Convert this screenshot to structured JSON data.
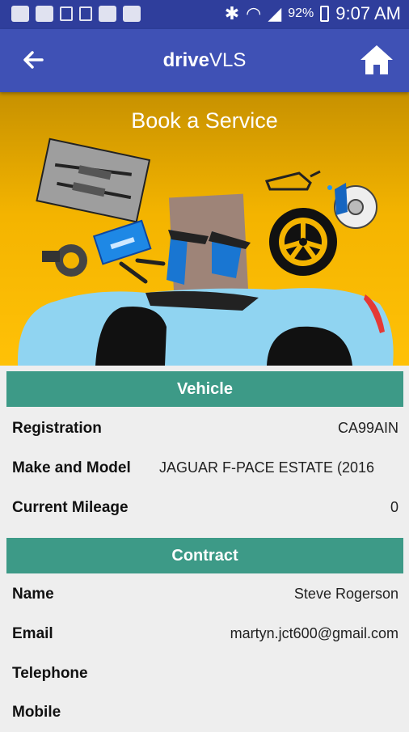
{
  "status_bar": {
    "battery": "92%",
    "time": "9:07 AM"
  },
  "app_bar": {
    "title_bold": "drive",
    "title_rest": "VLS"
  },
  "hero": {
    "heading": "Book a Service"
  },
  "vehicle": {
    "header": "Vehicle",
    "rows": [
      {
        "label": "Registration",
        "value": "CA99AIN"
      },
      {
        "label": "Make and Model",
        "value": "JAGUAR F-PACE ESTATE (2016"
      },
      {
        "label": "Current Mileage",
        "value": "0"
      }
    ]
  },
  "contract": {
    "header": "Contract",
    "rows": [
      {
        "label": "Name",
        "value": "Steve Rogerson"
      },
      {
        "label": "Email",
        "value": "martyn.jct600@gmail.com"
      },
      {
        "label": "Telephone",
        "value": ""
      },
      {
        "label": "Mobile",
        "value": ""
      }
    ]
  },
  "colors": {
    "status_bar": "#2f3e9c",
    "app_bar": "#3f51b5",
    "hero_yellow": "#ffc107",
    "section_header": "#3d9a87"
  }
}
